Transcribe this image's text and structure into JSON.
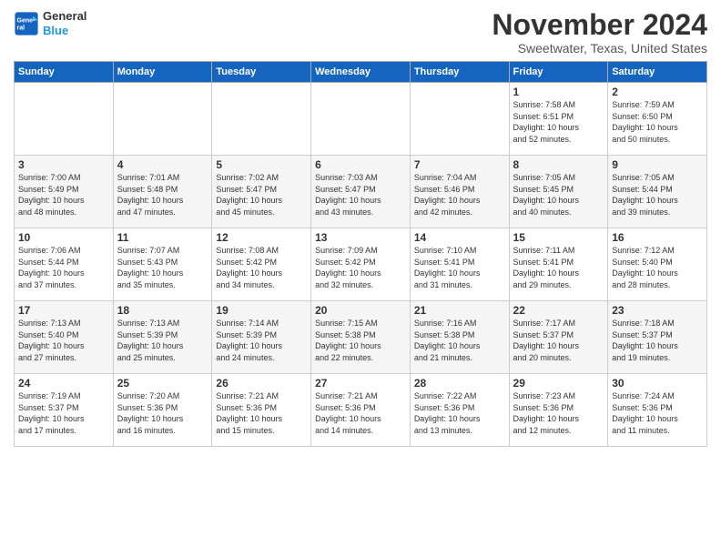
{
  "logo": {
    "line1": "General",
    "line2": "Blue"
  },
  "title": "November 2024",
  "location": "Sweetwater, Texas, United States",
  "days_header": [
    "Sunday",
    "Monday",
    "Tuesday",
    "Wednesday",
    "Thursday",
    "Friday",
    "Saturday"
  ],
  "weeks": [
    [
      {
        "num": "",
        "info": ""
      },
      {
        "num": "",
        "info": ""
      },
      {
        "num": "",
        "info": ""
      },
      {
        "num": "",
        "info": ""
      },
      {
        "num": "",
        "info": ""
      },
      {
        "num": "1",
        "info": "Sunrise: 7:58 AM\nSunset: 6:51 PM\nDaylight: 10 hours\nand 52 minutes."
      },
      {
        "num": "2",
        "info": "Sunrise: 7:59 AM\nSunset: 6:50 PM\nDaylight: 10 hours\nand 50 minutes."
      }
    ],
    [
      {
        "num": "3",
        "info": "Sunrise: 7:00 AM\nSunset: 5:49 PM\nDaylight: 10 hours\nand 48 minutes."
      },
      {
        "num": "4",
        "info": "Sunrise: 7:01 AM\nSunset: 5:48 PM\nDaylight: 10 hours\nand 47 minutes."
      },
      {
        "num": "5",
        "info": "Sunrise: 7:02 AM\nSunset: 5:47 PM\nDaylight: 10 hours\nand 45 minutes."
      },
      {
        "num": "6",
        "info": "Sunrise: 7:03 AM\nSunset: 5:47 PM\nDaylight: 10 hours\nand 43 minutes."
      },
      {
        "num": "7",
        "info": "Sunrise: 7:04 AM\nSunset: 5:46 PM\nDaylight: 10 hours\nand 42 minutes."
      },
      {
        "num": "8",
        "info": "Sunrise: 7:05 AM\nSunset: 5:45 PM\nDaylight: 10 hours\nand 40 minutes."
      },
      {
        "num": "9",
        "info": "Sunrise: 7:05 AM\nSunset: 5:44 PM\nDaylight: 10 hours\nand 39 minutes."
      }
    ],
    [
      {
        "num": "10",
        "info": "Sunrise: 7:06 AM\nSunset: 5:44 PM\nDaylight: 10 hours\nand 37 minutes."
      },
      {
        "num": "11",
        "info": "Sunrise: 7:07 AM\nSunset: 5:43 PM\nDaylight: 10 hours\nand 35 minutes."
      },
      {
        "num": "12",
        "info": "Sunrise: 7:08 AM\nSunset: 5:42 PM\nDaylight: 10 hours\nand 34 minutes."
      },
      {
        "num": "13",
        "info": "Sunrise: 7:09 AM\nSunset: 5:42 PM\nDaylight: 10 hours\nand 32 minutes."
      },
      {
        "num": "14",
        "info": "Sunrise: 7:10 AM\nSunset: 5:41 PM\nDaylight: 10 hours\nand 31 minutes."
      },
      {
        "num": "15",
        "info": "Sunrise: 7:11 AM\nSunset: 5:41 PM\nDaylight: 10 hours\nand 29 minutes."
      },
      {
        "num": "16",
        "info": "Sunrise: 7:12 AM\nSunset: 5:40 PM\nDaylight: 10 hours\nand 28 minutes."
      }
    ],
    [
      {
        "num": "17",
        "info": "Sunrise: 7:13 AM\nSunset: 5:40 PM\nDaylight: 10 hours\nand 27 minutes."
      },
      {
        "num": "18",
        "info": "Sunrise: 7:13 AM\nSunset: 5:39 PM\nDaylight: 10 hours\nand 25 minutes."
      },
      {
        "num": "19",
        "info": "Sunrise: 7:14 AM\nSunset: 5:39 PM\nDaylight: 10 hours\nand 24 minutes."
      },
      {
        "num": "20",
        "info": "Sunrise: 7:15 AM\nSunset: 5:38 PM\nDaylight: 10 hours\nand 22 minutes."
      },
      {
        "num": "21",
        "info": "Sunrise: 7:16 AM\nSunset: 5:38 PM\nDaylight: 10 hours\nand 21 minutes."
      },
      {
        "num": "22",
        "info": "Sunrise: 7:17 AM\nSunset: 5:37 PM\nDaylight: 10 hours\nand 20 minutes."
      },
      {
        "num": "23",
        "info": "Sunrise: 7:18 AM\nSunset: 5:37 PM\nDaylight: 10 hours\nand 19 minutes."
      }
    ],
    [
      {
        "num": "24",
        "info": "Sunrise: 7:19 AM\nSunset: 5:37 PM\nDaylight: 10 hours\nand 17 minutes."
      },
      {
        "num": "25",
        "info": "Sunrise: 7:20 AM\nSunset: 5:36 PM\nDaylight: 10 hours\nand 16 minutes."
      },
      {
        "num": "26",
        "info": "Sunrise: 7:21 AM\nSunset: 5:36 PM\nDaylight: 10 hours\nand 15 minutes."
      },
      {
        "num": "27",
        "info": "Sunrise: 7:21 AM\nSunset: 5:36 PM\nDaylight: 10 hours\nand 14 minutes."
      },
      {
        "num": "28",
        "info": "Sunrise: 7:22 AM\nSunset: 5:36 PM\nDaylight: 10 hours\nand 13 minutes."
      },
      {
        "num": "29",
        "info": "Sunrise: 7:23 AM\nSunset: 5:36 PM\nDaylight: 10 hours\nand 12 minutes."
      },
      {
        "num": "30",
        "info": "Sunrise: 7:24 AM\nSunset: 5:36 PM\nDaylight: 10 hours\nand 11 minutes."
      }
    ]
  ]
}
